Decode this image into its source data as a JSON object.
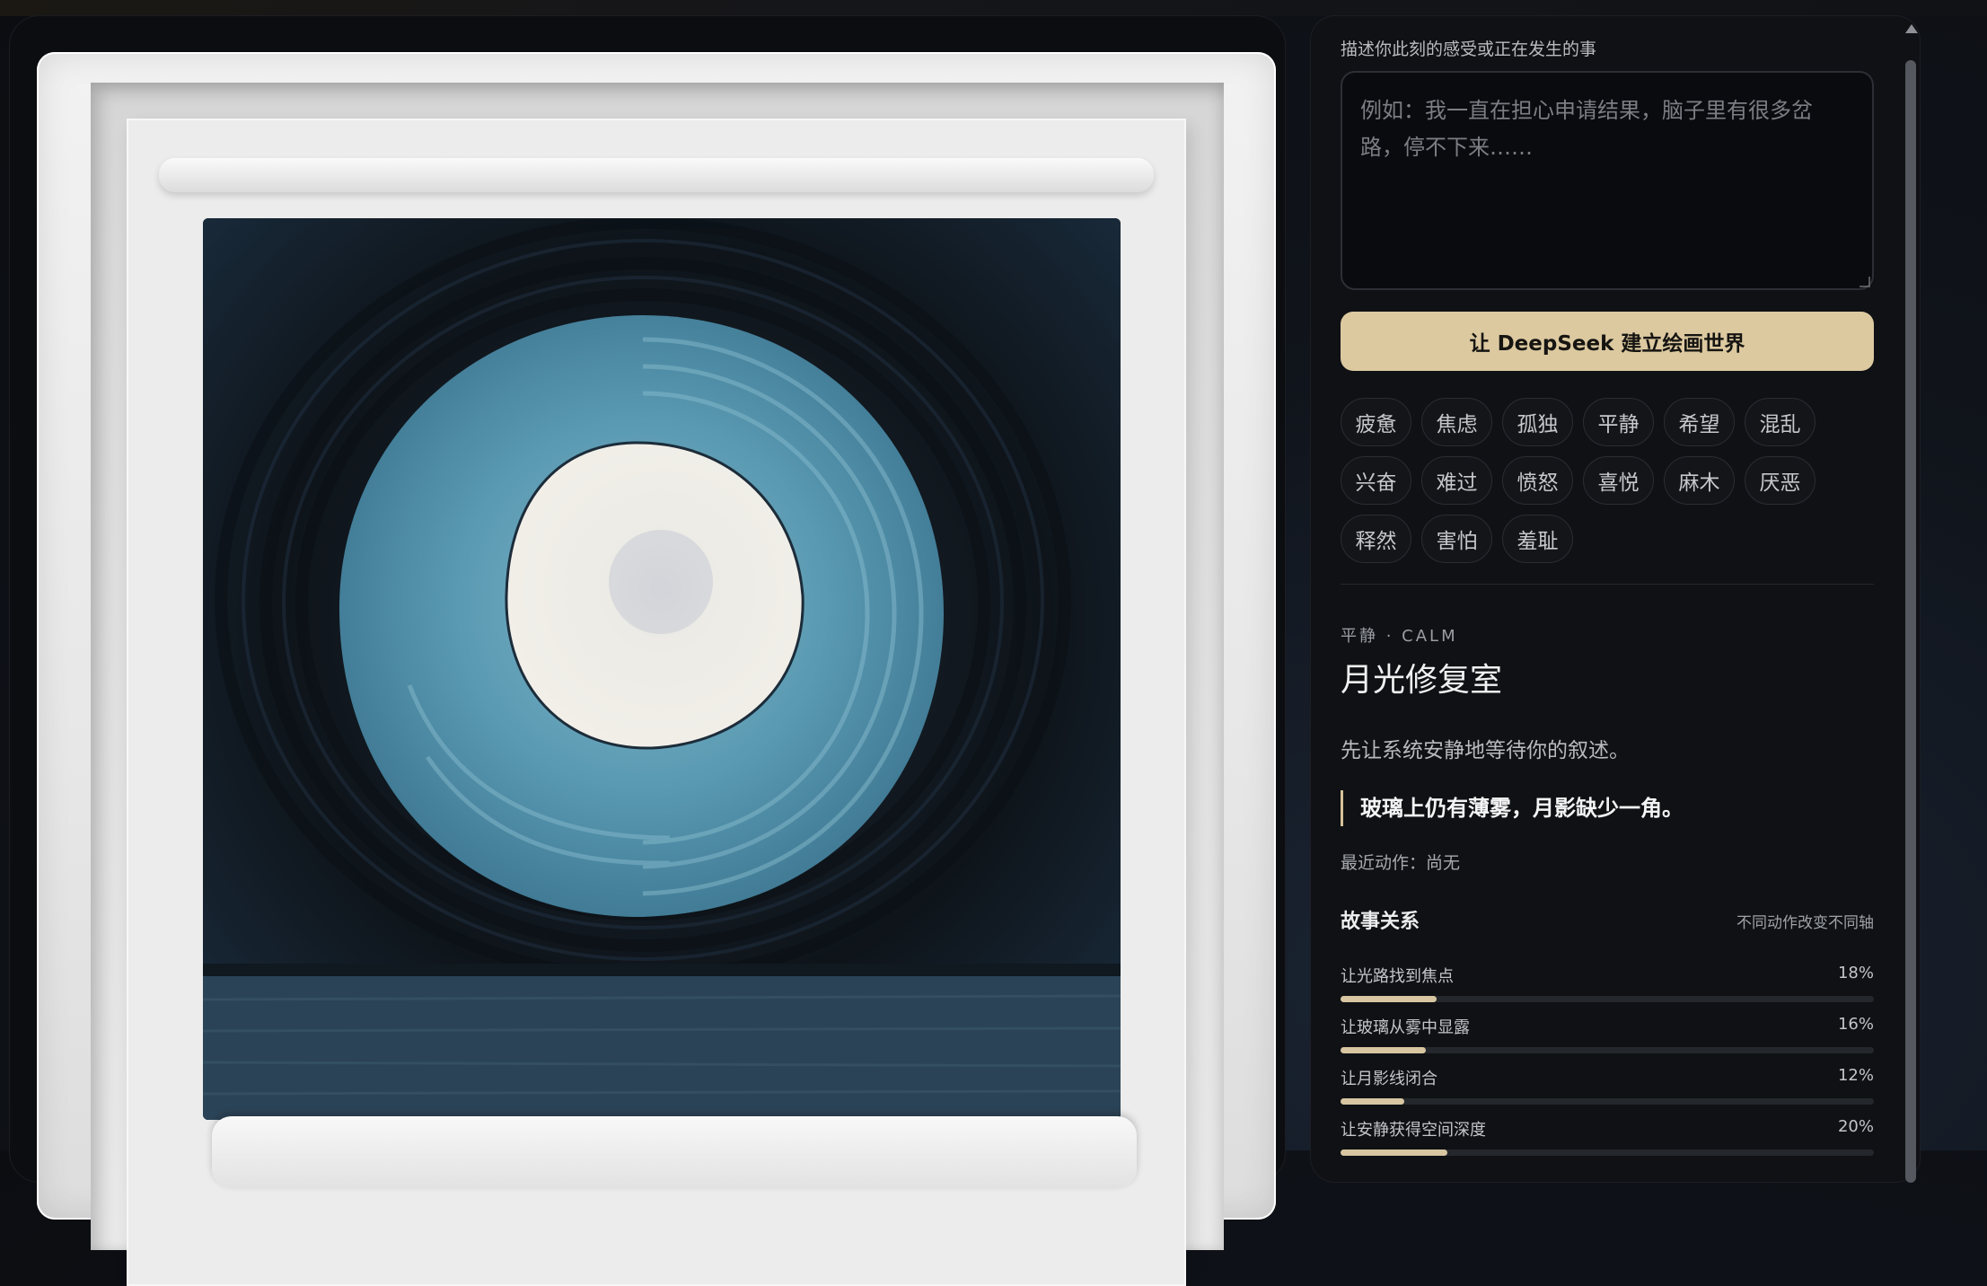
{
  "prompt": {
    "label": "描述你此刻的感受或正在发生的事",
    "placeholder": "例如：我一直在担心申请结果，脑子里有很多岔路，停不下来……",
    "value": ""
  },
  "cta_label": "让 DeepSeek 建立绘画世界",
  "emotions": [
    "疲惫",
    "焦虑",
    "孤独",
    "平静",
    "希望",
    "混乱",
    "兴奋",
    "难过",
    "愤怒",
    "喜悦",
    "麻木",
    "厌恶",
    "释然",
    "害怕",
    "羞耻"
  ],
  "mood": {
    "tag": "平静 · CALM",
    "title": "月光修复室",
    "description": "先让系统安静地等待你的叙述。",
    "quote": "玻璃上仍有薄雾，月影缺少一角。",
    "recent_action": "最近动作：尚无"
  },
  "story": {
    "title": "故事关系",
    "note": "不同动作改变不同轴",
    "metrics": [
      {
        "label": "让光路找到焦点",
        "percent": 18
      },
      {
        "label": "让玻璃从雾中显露",
        "percent": 16
      },
      {
        "label": "让月影线闭合",
        "percent": 12
      },
      {
        "label": "让安静获得空间深度",
        "percent": 20
      }
    ]
  },
  "colors": {
    "accent": "#dcc9a0",
    "panel": "#0f1114",
    "painting_teal": "#4a8fa8",
    "painting_dark": "#0d141b"
  }
}
